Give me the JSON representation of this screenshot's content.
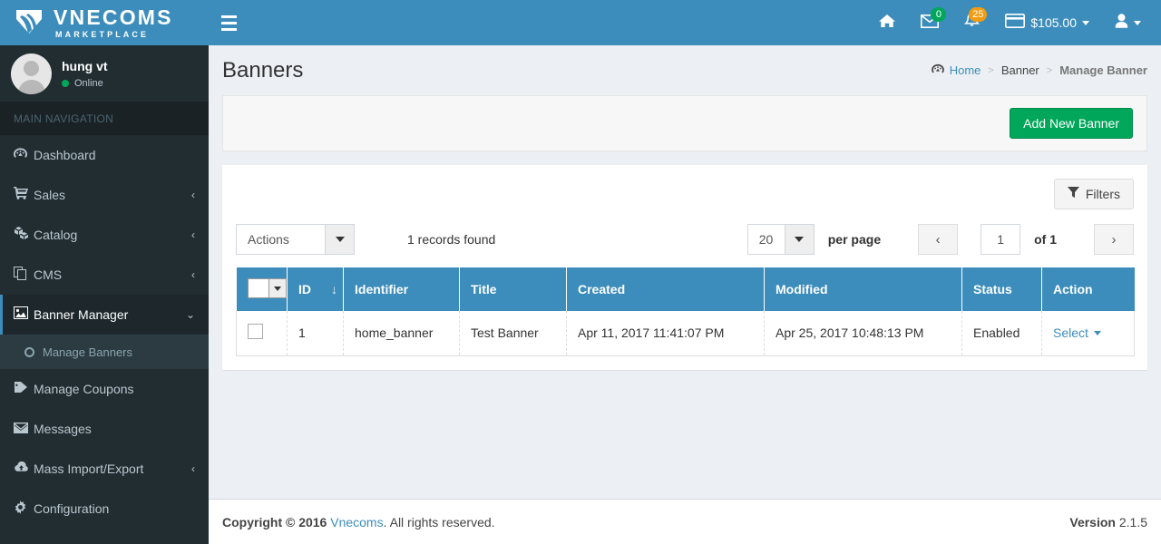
{
  "brand": {
    "name": "VNECOMS",
    "tagline": "MARKETPLACE",
    "logo_icon": "vnecoms-leaf-logo"
  },
  "user_panel": {
    "name": "hung vt",
    "status": "Online",
    "avatar_icon": "user-avatar-icon"
  },
  "sidebar": {
    "header": "MAIN NAVIGATION",
    "items": [
      {
        "label": "Dashboard",
        "icon": "dashboard-icon",
        "arrow": "",
        "active": false
      },
      {
        "label": "Sales",
        "icon": "cart-icon",
        "arrow": "‹",
        "active": false
      },
      {
        "label": "Catalog",
        "icon": "cubes-icon",
        "arrow": "‹",
        "active": false
      },
      {
        "label": "CMS",
        "icon": "copy-icon",
        "arrow": "‹",
        "active": false
      },
      {
        "label": "Banner Manager",
        "icon": "image-icon",
        "arrow": "⌄",
        "active": true
      },
      {
        "label": "Manage Coupons",
        "icon": "tag-icon",
        "arrow": "",
        "active": false
      },
      {
        "label": "Messages",
        "icon": "envelope-icon",
        "arrow": "",
        "active": false
      },
      {
        "label": "Mass Import/Export",
        "icon": "cloud-upload-icon",
        "arrow": "‹",
        "active": false
      },
      {
        "label": "Configuration",
        "icon": "gear-icon",
        "arrow": "",
        "active": false
      }
    ],
    "submenu": {
      "label": "Manage Banners",
      "icon": "circle-o-icon"
    }
  },
  "navbar": {
    "menu_toggle_icon": "hamburger-icon",
    "home_icon": "home-icon",
    "messages": {
      "icon": "envelope-icon",
      "badge": "0",
      "badge_color": "#00a65a"
    },
    "notifications": {
      "icon": "bell-icon",
      "badge": "25",
      "badge_color": "#f39c12"
    },
    "wallet": {
      "icon": "credit-card-icon",
      "amount": "$105.00"
    },
    "account": {
      "icon": "user-icon"
    }
  },
  "header": {
    "title": "Banners",
    "breadcrumb": {
      "home": "Home",
      "home_icon": "dashboard-icon",
      "separator": ">",
      "parent": "Banner",
      "current": "Manage Banner"
    }
  },
  "toolbar": {
    "add_new_label": "Add New Banner",
    "add_new_color": "#00a65a",
    "filters_label": "Filters",
    "filters_icon": "funnel-icon"
  },
  "grid_controls": {
    "actions_label": "Actions",
    "records_found": "1 records found",
    "per_page_value": "20",
    "per_page_label": "per page",
    "prev_icon": "‹",
    "next_icon": "›",
    "page_value": "1",
    "of_label": "of 1"
  },
  "table": {
    "columns": [
      {
        "key": "select",
        "label": ""
      },
      {
        "key": "id",
        "label": "ID",
        "sort_icon": "↓"
      },
      {
        "key": "identifier",
        "label": "Identifier"
      },
      {
        "key": "title",
        "label": "Title"
      },
      {
        "key": "created",
        "label": "Created"
      },
      {
        "key": "modified",
        "label": "Modified"
      },
      {
        "key": "status",
        "label": "Status"
      },
      {
        "key": "action",
        "label": "Action"
      }
    ],
    "rows": [
      {
        "id": "1",
        "identifier": "home_banner",
        "title": "Test Banner",
        "created": "Apr 11, 2017 11:41:07 PM",
        "modified": "Apr 25, 2017 10:48:13 PM",
        "status": "Enabled",
        "action": "Select"
      }
    ]
  },
  "footer": {
    "copyright_bold": "Copyright © 2016",
    "company": "Vnecoms",
    "rights": ". All rights reserved.",
    "version_label": "Version",
    "version_number": "2.1.5"
  },
  "colors": {
    "header_blue": "#3c8dbc",
    "sidebar_dark": "#222d32",
    "content_bg": "#ecf0f5",
    "success_green": "#00a65a",
    "warning_yellow": "#f39c12",
    "link_blue": "#3c8dbc"
  }
}
